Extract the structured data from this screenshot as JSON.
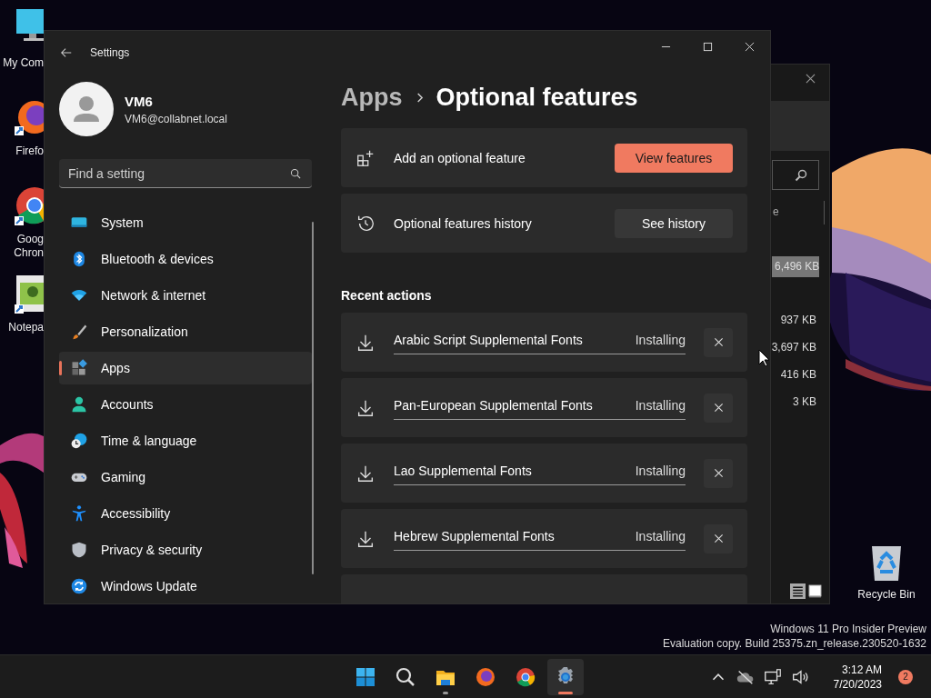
{
  "desktop": {
    "icons": [
      {
        "kind": "computer",
        "lines": [
          "My Com"
        ]
      },
      {
        "kind": "firefox",
        "lines": [
          "Firefo"
        ]
      },
      {
        "kind": "chrome",
        "lines": [
          "Goog",
          "Chron"
        ]
      },
      {
        "kind": "notepad",
        "lines": [
          "Notepa"
        ]
      }
    ],
    "recycle_bin": {
      "label": "Recycle Bin"
    },
    "watermark": [
      "Windows 11 Pro Insider Preview",
      "Evaluation copy. Build 25375.zn_release.230520-1632"
    ]
  },
  "background_window": {
    "column_fragment": "e",
    "sizes": [
      {
        "text": "6,496 KB",
        "selected": true
      },
      {
        "text": "937 KB",
        "selected": false
      },
      {
        "text": "3,697 KB",
        "selected": false
      },
      {
        "text": "416 KB",
        "selected": false
      },
      {
        "text": "3 KB",
        "selected": false
      }
    ],
    "views": [
      {
        "kind": "details",
        "selected": true
      },
      {
        "kind": "thumbnails",
        "selected": false
      }
    ]
  },
  "settings": {
    "window": {
      "title": "Settings"
    },
    "user": {
      "name": "VM6",
      "email": "VM6@collabnet.local"
    },
    "search": {
      "placeholder": "Find a setting"
    },
    "nav": [
      {
        "label": "System",
        "kind": "system",
        "selected": false
      },
      {
        "label": "Bluetooth & devices",
        "kind": "bluetooth",
        "selected": false
      },
      {
        "label": "Network & internet",
        "kind": "network",
        "selected": false
      },
      {
        "label": "Personalization",
        "kind": "personalization",
        "selected": false
      },
      {
        "label": "Apps",
        "kind": "apps",
        "selected": true
      },
      {
        "label": "Accounts",
        "kind": "accounts",
        "selected": false
      },
      {
        "label": "Time & language",
        "kind": "time",
        "selected": false
      },
      {
        "label": "Gaming",
        "kind": "gaming",
        "selected": false
      },
      {
        "label": "Accessibility",
        "kind": "accessibility",
        "selected": false
      },
      {
        "label": "Privacy & security",
        "kind": "privacy",
        "selected": false
      },
      {
        "label": "Windows Update",
        "kind": "update",
        "selected": false
      }
    ],
    "breadcrumb": [
      "Apps",
      "Optional features"
    ],
    "actions": [
      {
        "kind": "add",
        "label": "Add an optional feature",
        "button": "View features",
        "primary": true
      },
      {
        "kind": "history",
        "label": "Optional features history",
        "button": "See history",
        "primary": false
      }
    ],
    "recent_title": "Recent actions",
    "recent": [
      {
        "name": "Arabic Script Supplemental Fonts",
        "status": "Installing"
      },
      {
        "name": "Pan-European Supplemental Fonts",
        "status": "Installing"
      },
      {
        "name": "Lao Supplemental Fonts",
        "status": "Installing"
      },
      {
        "name": "Hebrew Supplemental Fonts",
        "status": "Installing"
      }
    ]
  },
  "taskbar": {
    "apps": [
      {
        "kind": "start",
        "running": false,
        "active": false
      },
      {
        "kind": "search",
        "running": false,
        "active": false
      },
      {
        "kind": "folder",
        "running": true,
        "active": false
      },
      {
        "kind": "firefox",
        "running": false,
        "active": false
      },
      {
        "kind": "chrome",
        "running": false,
        "active": false
      },
      {
        "kind": "settings",
        "running": true,
        "active": true
      }
    ],
    "tray": [
      {
        "kind": "caret"
      },
      {
        "kind": "cloud-off"
      },
      {
        "kind": "network"
      },
      {
        "kind": "volume"
      }
    ],
    "time": "3:12 AM",
    "date": "7/20/2023",
    "notifications": "2"
  }
}
